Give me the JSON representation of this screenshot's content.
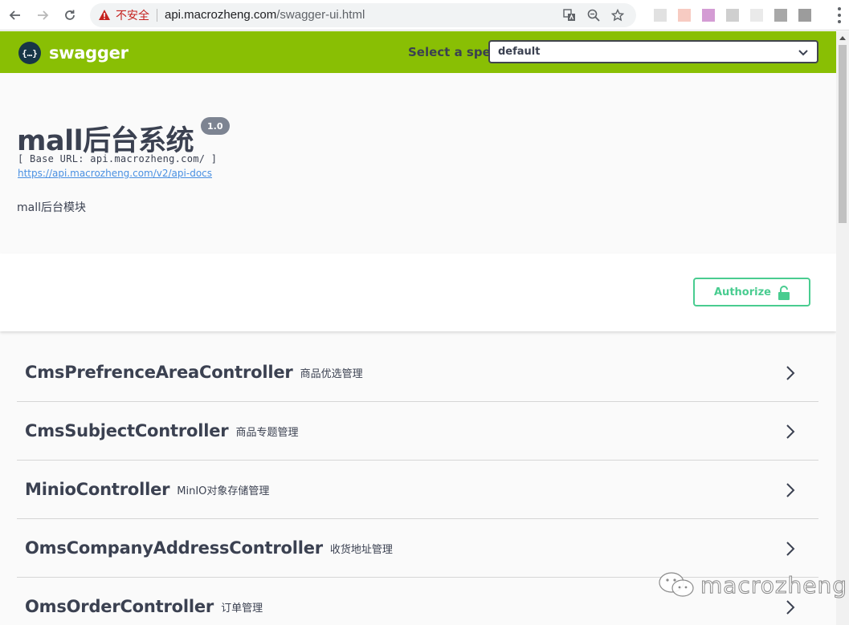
{
  "browser": {
    "insecure_label": "不安全",
    "url_host": "api.macrozheng.com",
    "url_path": "/swagger-ui.html"
  },
  "topbar": {
    "logo_text": "swagger",
    "spec_label": "Select a spec",
    "spec_selected": "default"
  },
  "info": {
    "title": "mall后台系统",
    "version": "1.0",
    "base_url": "[ Base URL: api.macrozheng.com/ ]",
    "docs_link": "https://api.macrozheng.com/v2/api-docs",
    "description": "mall后台模块"
  },
  "scheme": {
    "authorize_label": "Authorize"
  },
  "tags": [
    {
      "name": "CmsPrefrenceAreaController",
      "description": "商品优选管理"
    },
    {
      "name": "CmsSubjectController",
      "description": "商品专题管理"
    },
    {
      "name": "MinioController",
      "description": "MinIO对象存储管理"
    },
    {
      "name": "OmsCompanyAddressController",
      "description": "收货地址管理"
    },
    {
      "name": "OmsOrderController",
      "description": "订单管理"
    }
  ],
  "watermark": {
    "text": "macrozheng"
  },
  "colors": {
    "topbar": "#89bf04",
    "authorize": "#49cc90",
    "link": "#4990e2",
    "text": "#3b4151"
  }
}
